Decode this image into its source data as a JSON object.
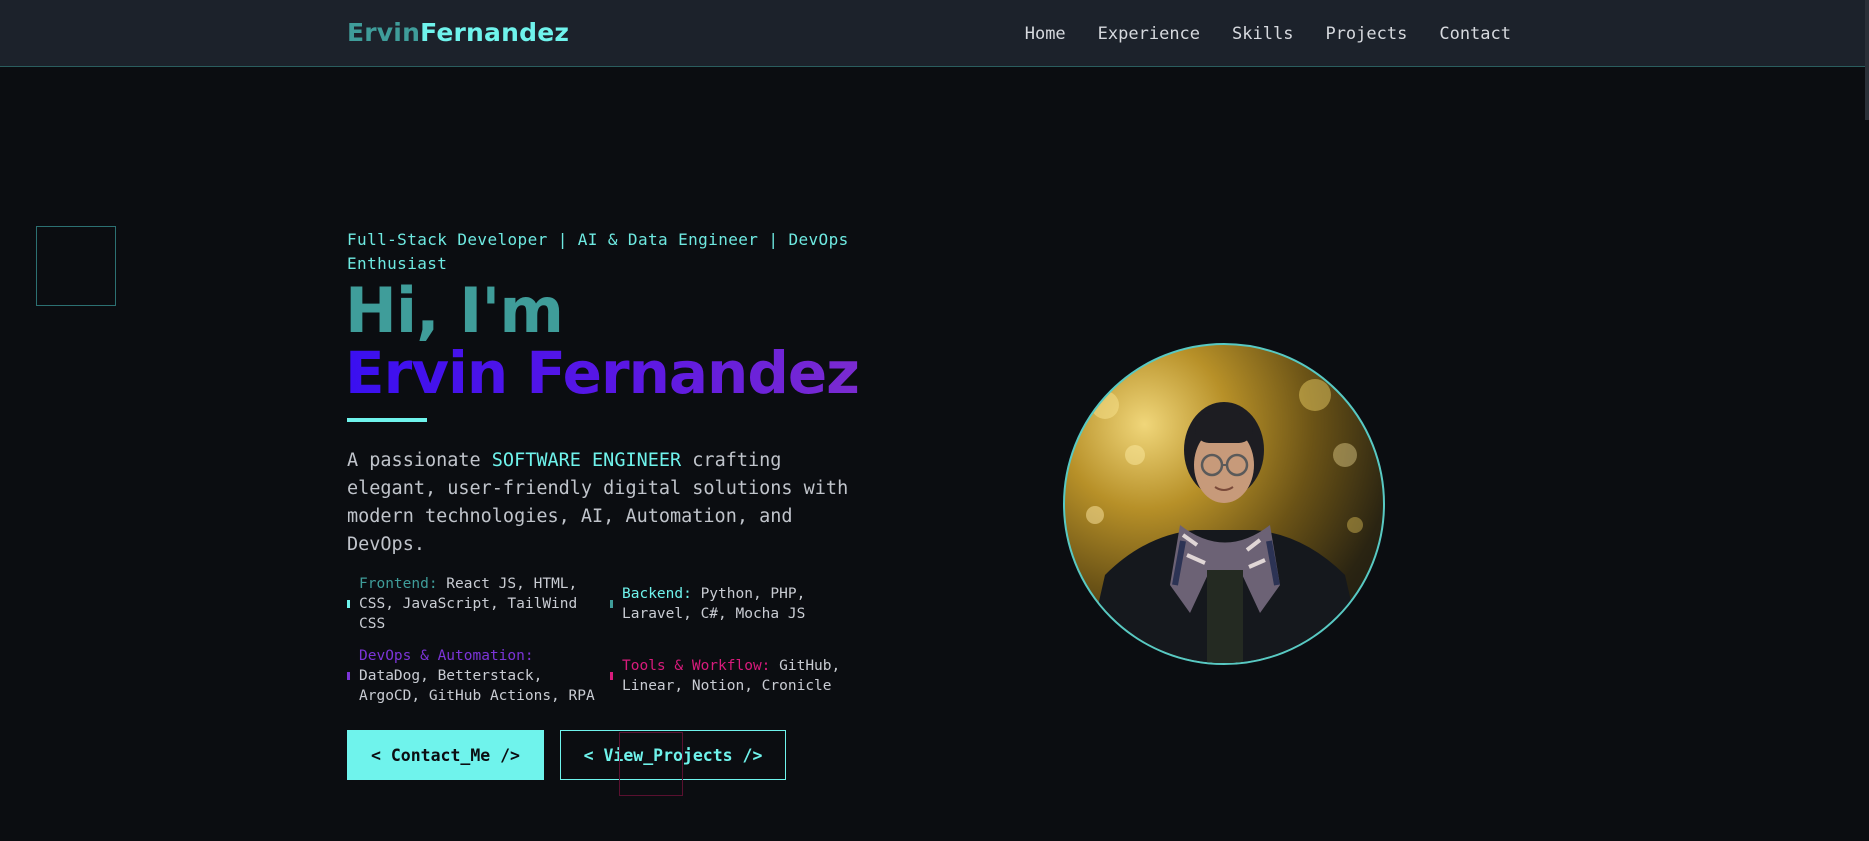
{
  "nav": {
    "logo_first": "Ervin",
    "logo_last": "Fernandez",
    "items": [
      "Home",
      "Experience",
      "Skills",
      "Projects",
      "Contact"
    ]
  },
  "hero": {
    "tagline": "Full-Stack Developer | AI & Data Engineer | DevOps Enthusiast",
    "greeting": "Hi, I'm",
    "name": "Ervin Fernandez",
    "intro_before": "A passionate ",
    "intro_highlight": "SOFTWARE ENGINEER",
    "intro_after": " crafting elegant, user-friendly digital solutions with modern technologies, AI, Automation, and DevOps."
  },
  "skills": [
    {
      "label": "Frontend:",
      "value": " React JS, HTML, CSS, JavaScript, TailWind CSS"
    },
    {
      "label": "Backend:",
      "value": " Python, PHP, Laravel, C#, Mocha JS"
    },
    {
      "label": "DevOps & Automation:",
      "value": " DataDog, Betterstack, ArgoCD, GitHub Actions, RPA"
    },
    {
      "label": "Tools & Workflow:",
      "value": " GitHub, Linear, Notion, Cronicle"
    }
  ],
  "buttons": {
    "contact": "< Contact_Me />",
    "projects": "< View_Projects />"
  },
  "colors": {
    "accent": "#6ff3ec",
    "accent_dark": "#3f9d9a",
    "name_gradient_start": "#3a0ff0",
    "name_gradient_end": "#7b2bd0",
    "devops": "#7c34d8",
    "tools": "#d81b7c",
    "background": "#0b0d11",
    "nav_bg": "#1c222b"
  },
  "avatar": {
    "icon": "profile-photo"
  }
}
